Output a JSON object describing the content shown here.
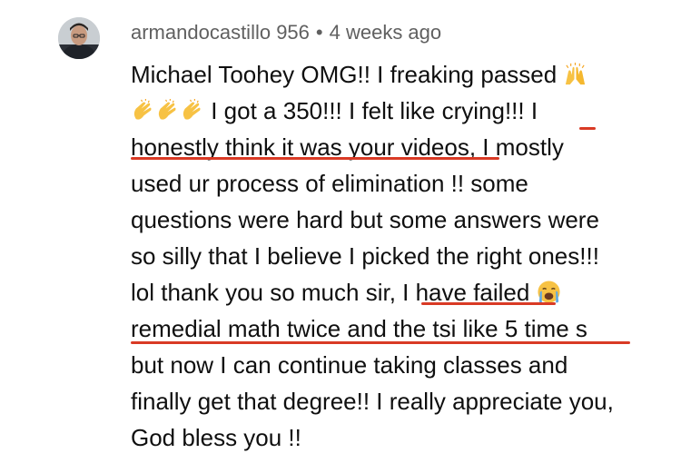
{
  "comment": {
    "author": "armandocastillo 956",
    "separator": "•",
    "time_ago": "4 weeks ago",
    "lines": [
      "Michael Toohey OMG!! I freaking passed",
      "I got a 350!!! I felt like crying!!! I",
      "honestly think it was your videos, I mostly",
      "used ur process of elimination !! some",
      "questions were hard but some answers were",
      "so silly that I believe I picked the right ones!!!",
      "lol thank you so much sir, I have failed",
      "remedial math twice and the tsi like 5 time s",
      "but now I can continue taking classes and",
      "finally get that degree!! I really appreciate you,",
      "God bless you !!"
    ],
    "emojis": {
      "raised_hands": "raised-hands-emoji",
      "clapping": "clapping-hands-emoji",
      "crying": "loudly-crying-face-emoji"
    },
    "underline_color": "#d93a25"
  }
}
